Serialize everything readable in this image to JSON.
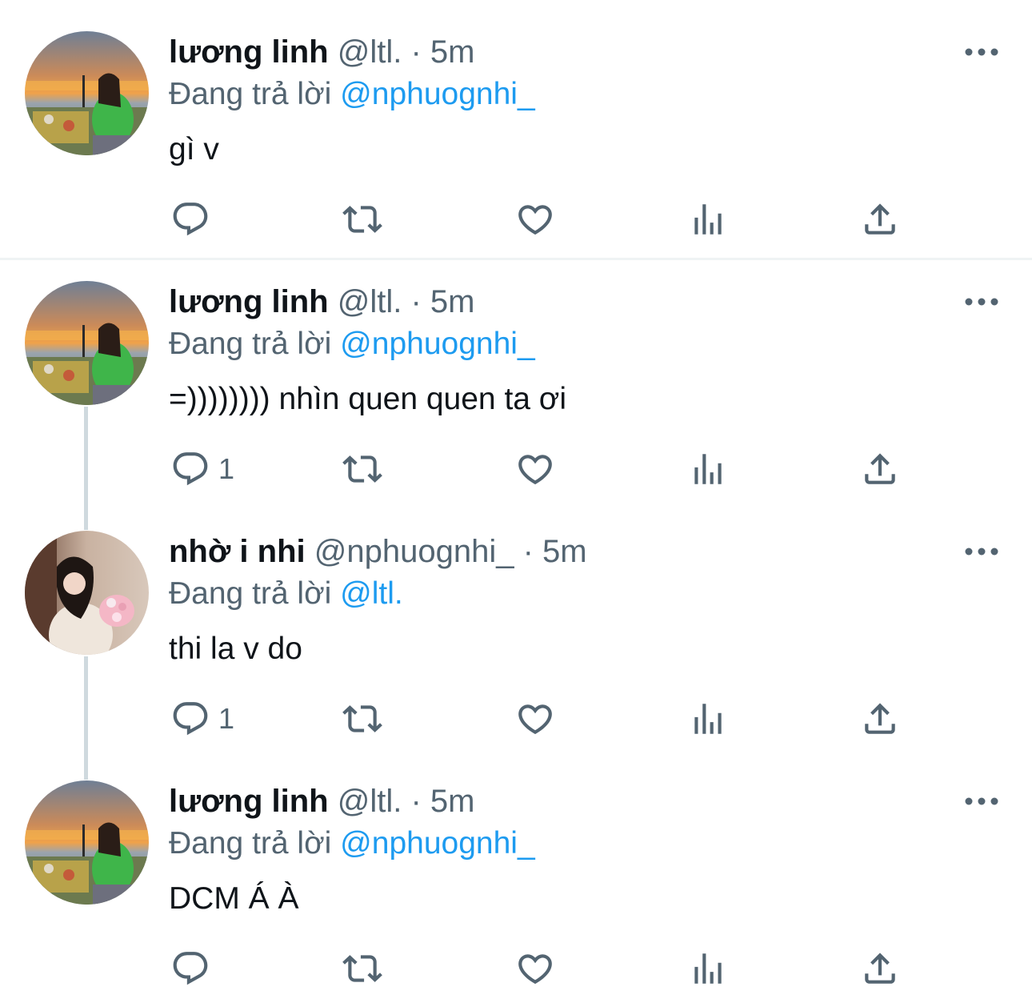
{
  "colors": {
    "accent": "#1d9bf0",
    "meta": "#536471",
    "text": "#0f1419",
    "thread_line": "#cfd9de"
  },
  "tweets": [
    {
      "name": "lương linh",
      "handle": "@ltl.",
      "separator": "·",
      "time": "5m",
      "reply_prefix": "Đang trả lời",
      "reply_to": "@nphuognhi_",
      "text": "gì v",
      "reply_count": "",
      "avatar": "beach-sunset-avatar"
    },
    {
      "name": "lương linh",
      "handle": "@ltl.",
      "separator": "·",
      "time": "5m",
      "reply_prefix": "Đang trả lời",
      "reply_to": "@nphuognhi_",
      "text": "=)))))))) nhìn quen quen ta ơi",
      "reply_count": "1",
      "avatar": "beach-sunset-avatar"
    },
    {
      "name": "nhờ i nhi",
      "handle": "@nphuognhi_",
      "separator": "·",
      "time": "5m",
      "reply_prefix": "Đang trả lời",
      "reply_to": "@ltl.",
      "text": "thi la v do",
      "reply_count": "1",
      "avatar": "flowers-portrait-avatar"
    },
    {
      "name": "lương linh",
      "handle": "@ltl.",
      "separator": "·",
      "time": "5m",
      "reply_prefix": "Đang trả lời",
      "reply_to": "@nphuognhi_",
      "text": "DCM Á À",
      "reply_count": "",
      "avatar": "beach-sunset-avatar"
    }
  ],
  "icons": {
    "reply": "reply-icon",
    "retweet": "retweet-icon",
    "like": "like-icon",
    "views": "views-icon",
    "share": "share-icon",
    "more": "more-icon"
  }
}
